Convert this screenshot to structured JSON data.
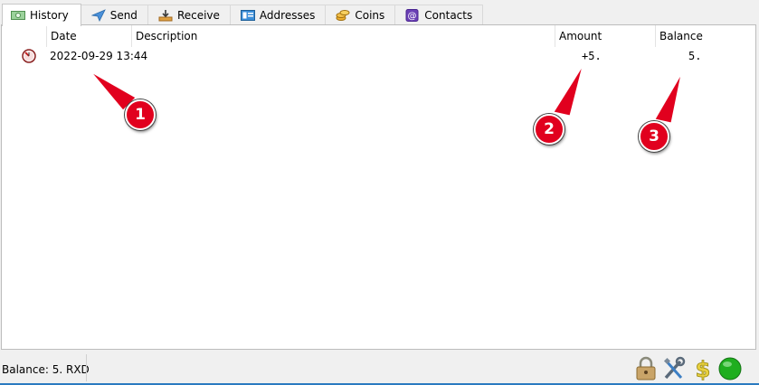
{
  "tabs": [
    {
      "label": "History",
      "icon": "history-icon",
      "active": true
    },
    {
      "label": "Send",
      "icon": "send-icon",
      "active": false
    },
    {
      "label": "Receive",
      "icon": "receive-icon",
      "active": false
    },
    {
      "label": "Addresses",
      "icon": "addresses-icon",
      "active": false
    },
    {
      "label": "Coins",
      "icon": "coins-icon",
      "active": false
    },
    {
      "label": "Contacts",
      "icon": "contacts-icon",
      "active": false
    }
  ],
  "history": {
    "columns": {
      "date": "Date",
      "description": "Description",
      "amount": "Amount",
      "balance": "Balance"
    },
    "rows": [
      {
        "status_icon": "clock-icon",
        "date": "2022-09-29 13:44",
        "description": "",
        "amount": "+5.",
        "balance": "5."
      }
    ]
  },
  "status": {
    "balance_text": "Balance: 5. RXD",
    "icons": [
      "lock-icon",
      "preferences-tools-icon",
      "seed-dollar-icon",
      "network-status-icon"
    ]
  },
  "callouts": [
    "1",
    "2",
    "3"
  ],
  "colors": {
    "callout_red": "#e1001e",
    "network_green": "#1fae1f",
    "accent_blue": "#2a7ac0"
  }
}
